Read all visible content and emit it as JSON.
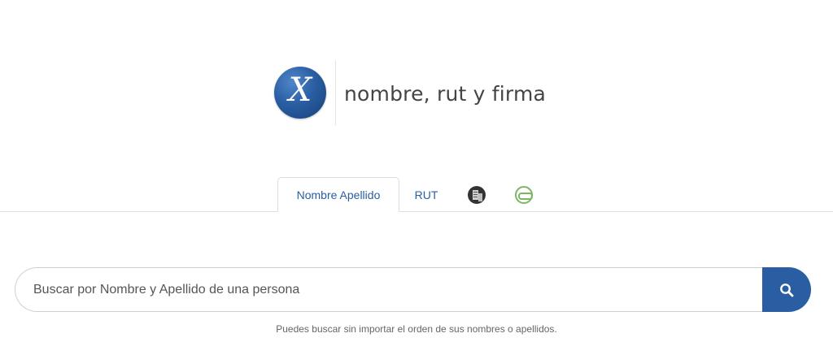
{
  "logo": {
    "mark": "X",
    "text": "nombre, rut y firma"
  },
  "tabs": [
    {
      "label": "Nombre Apellido",
      "active": true
    },
    {
      "label": "RUT",
      "active": false
    },
    {
      "icon": "building-icon",
      "active": false
    },
    {
      "icon": "vehicle-icon",
      "active": false
    }
  ],
  "search": {
    "placeholder": "Buscar por Nombre y Apellido de una persona",
    "value": "",
    "button_icon": "search-icon",
    "hint": "Puedes buscar sin importar el orden de sus nombres o apellidos."
  },
  "colors": {
    "accent": "#2a5ea3",
    "vehicle_icon": "#7bb661",
    "building_icon": "#333333",
    "border": "#dddddd"
  }
}
